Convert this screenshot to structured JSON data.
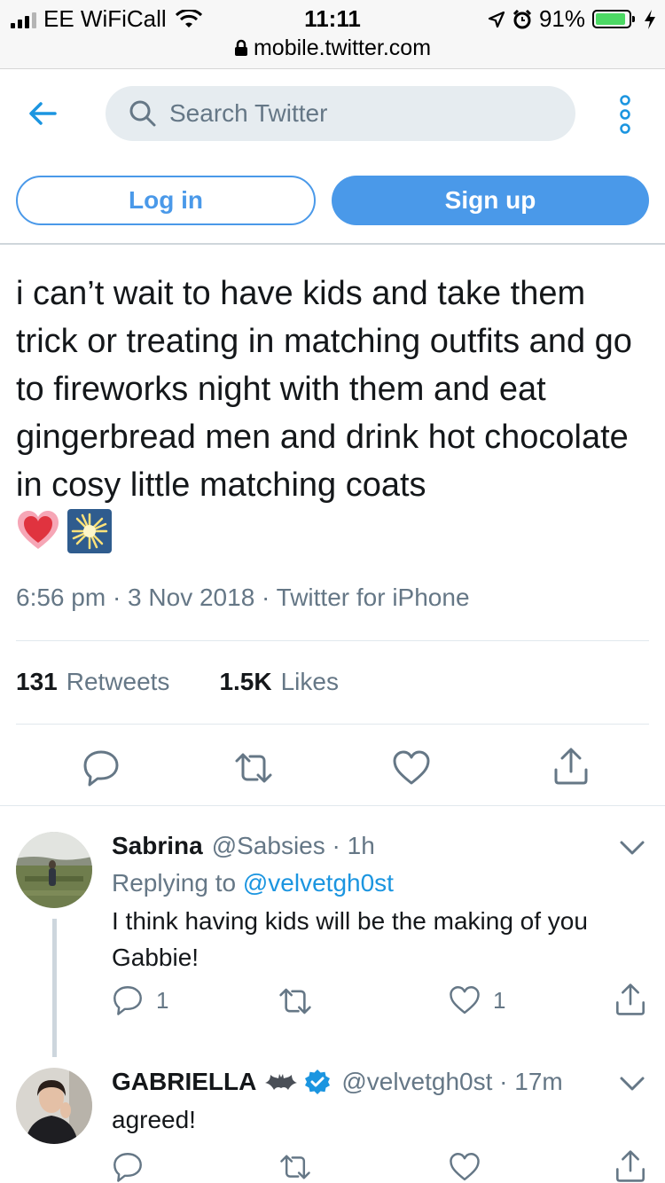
{
  "status_bar": {
    "carrier": "EE WiFiCall",
    "time": "11:11",
    "battery": "91%",
    "battery_level": 0.91,
    "url": "mobile.twitter.com"
  },
  "header": {
    "search_placeholder": "Search Twitter",
    "login_label": "Log in",
    "signup_label": "Sign up"
  },
  "tweet": {
    "text": "i can’t wait to have kids and take them trick or treating in matching outfits and go to fireworks night with them and eat gingerbread men and drink hot chocolate in cosy little matching coats",
    "emojis": [
      "heart-emoji",
      "sparkler-emoji"
    ],
    "meta": "6:56 pm · 3 Nov 2018 · Twitter for iPhone",
    "retweets_count": "131",
    "retweets_label": "Retweets",
    "likes_count": "1.5K",
    "likes_label": "Likes"
  },
  "replies": [
    {
      "name": "Sabrina",
      "handle": "@Sabsies · 1h",
      "replying_prefix": "Replying to",
      "replying_to": "@velvetgh0st",
      "text": "I think having kids will be the making of you Gabbie!",
      "reply_count": "1",
      "like_count": "1"
    },
    {
      "name": "GABRIELLA",
      "name_emoji": "bat-emoji",
      "verified": true,
      "handle": "@velvetgh0st · 17m",
      "text": "agreed!"
    }
  ],
  "colors": {
    "accent": "#4a99e9",
    "link": "#1b95e0",
    "muted": "#657786",
    "text": "#14171a"
  }
}
